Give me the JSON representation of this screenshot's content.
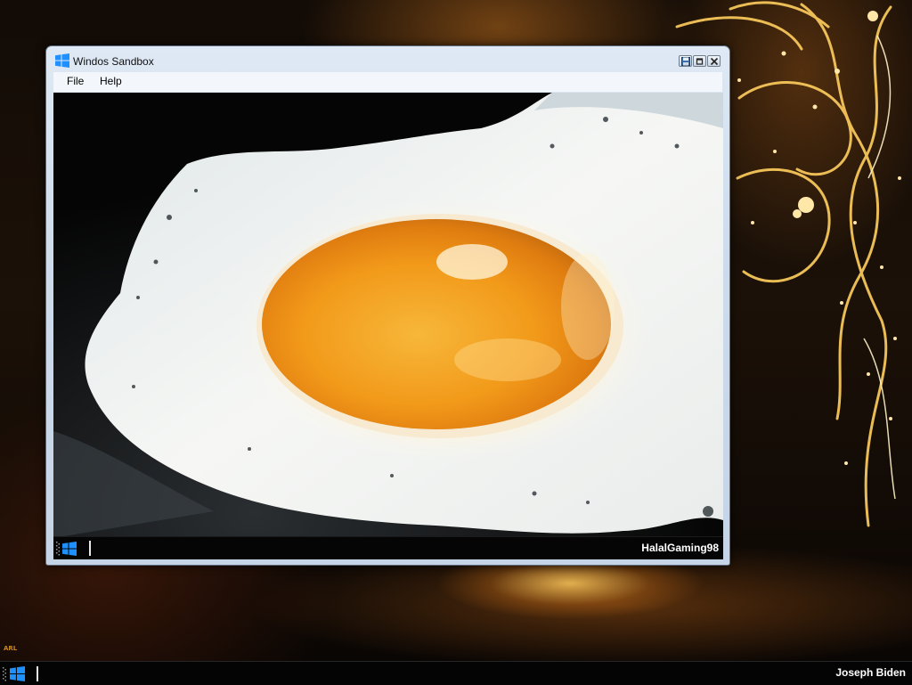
{
  "desktop": {
    "wallpaper": "dark-wood-gold-swirls",
    "brand_mark": "ARL",
    "accent_color": "#f5b84a"
  },
  "window": {
    "title": "Windos Sandbox",
    "icon": "windows-logo-icon",
    "caption_buttons": [
      "save-icon",
      "restore-icon",
      "close-icon"
    ],
    "menu": [
      {
        "label": "File"
      },
      {
        "label": "Help"
      }
    ],
    "content": {
      "image": "fried-egg-photo",
      "inner_taskbar": {
        "start_icon": "windows-logo-icon",
        "username": "HalalGaming98"
      }
    }
  },
  "taskbar": {
    "start_icon": "windows-logo-icon",
    "username": "Joseph Biden",
    "accent_color": "#1e90ff"
  }
}
